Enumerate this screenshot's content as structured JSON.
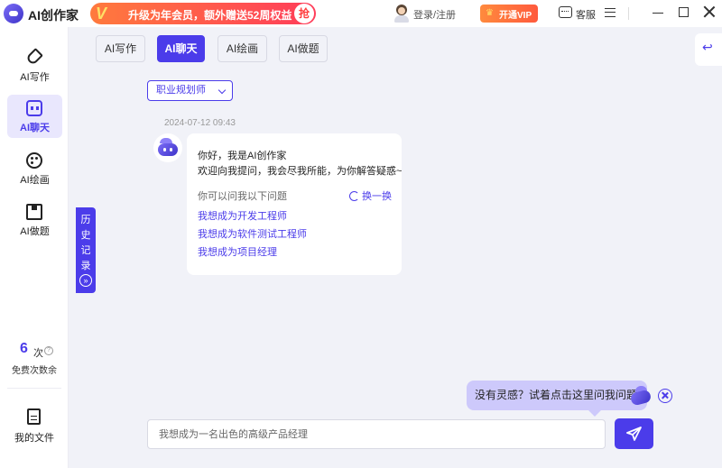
{
  "app": {
    "name": "AI创作家"
  },
  "promo": {
    "badge": "V",
    "text": "升级为年会员，额外赠送52周权益",
    "action": "抢"
  },
  "header": {
    "login": "登录/注册",
    "vip": "开通VIP",
    "service": "客服"
  },
  "sidebar": {
    "items": [
      {
        "label": "AI写作",
        "icon": "pen-icon",
        "active": false
      },
      {
        "label": "AI聊天",
        "icon": "chat-icon",
        "active": true
      },
      {
        "label": "AI绘画",
        "icon": "palette-icon",
        "active": false
      },
      {
        "label": "AI做题",
        "icon": "book-icon",
        "active": false
      }
    ],
    "quota": {
      "count": "6",
      "unit": "次",
      "help": "?",
      "label": "免费次数余"
    },
    "files": {
      "label": "我的文件"
    }
  },
  "tabs": [
    {
      "label": "AI写作"
    },
    {
      "label": "AI聊天",
      "active": true
    },
    {
      "label": "AI绘画"
    },
    {
      "label": "AI做题"
    }
  ],
  "chat": {
    "role": "职业规划师",
    "timestamp": "2024-07-12 09:43",
    "greeting": "你好，我是AI创作家",
    "intro": "欢迎向我提问，我会尽我所能，为你解答疑惑~",
    "ask_label": "你可以问我以下问题",
    "refresh": "换一换",
    "suggestions": [
      "我想成为开发工程师",
      "我想成为软件测试工程师",
      "我想成为项目经理"
    ]
  },
  "history": {
    "label": "历史记录",
    "icon": "»"
  },
  "hint": {
    "text": "没有灵感？试着点击这里问我问题"
  },
  "input": {
    "placeholder": "我想成为一名出色的高级产品经理"
  },
  "colors": {
    "accent": "#4b3cea",
    "background": "#f1f2f8",
    "hint_bg": "#cdc9fb",
    "promo": "#ff5a3d"
  }
}
